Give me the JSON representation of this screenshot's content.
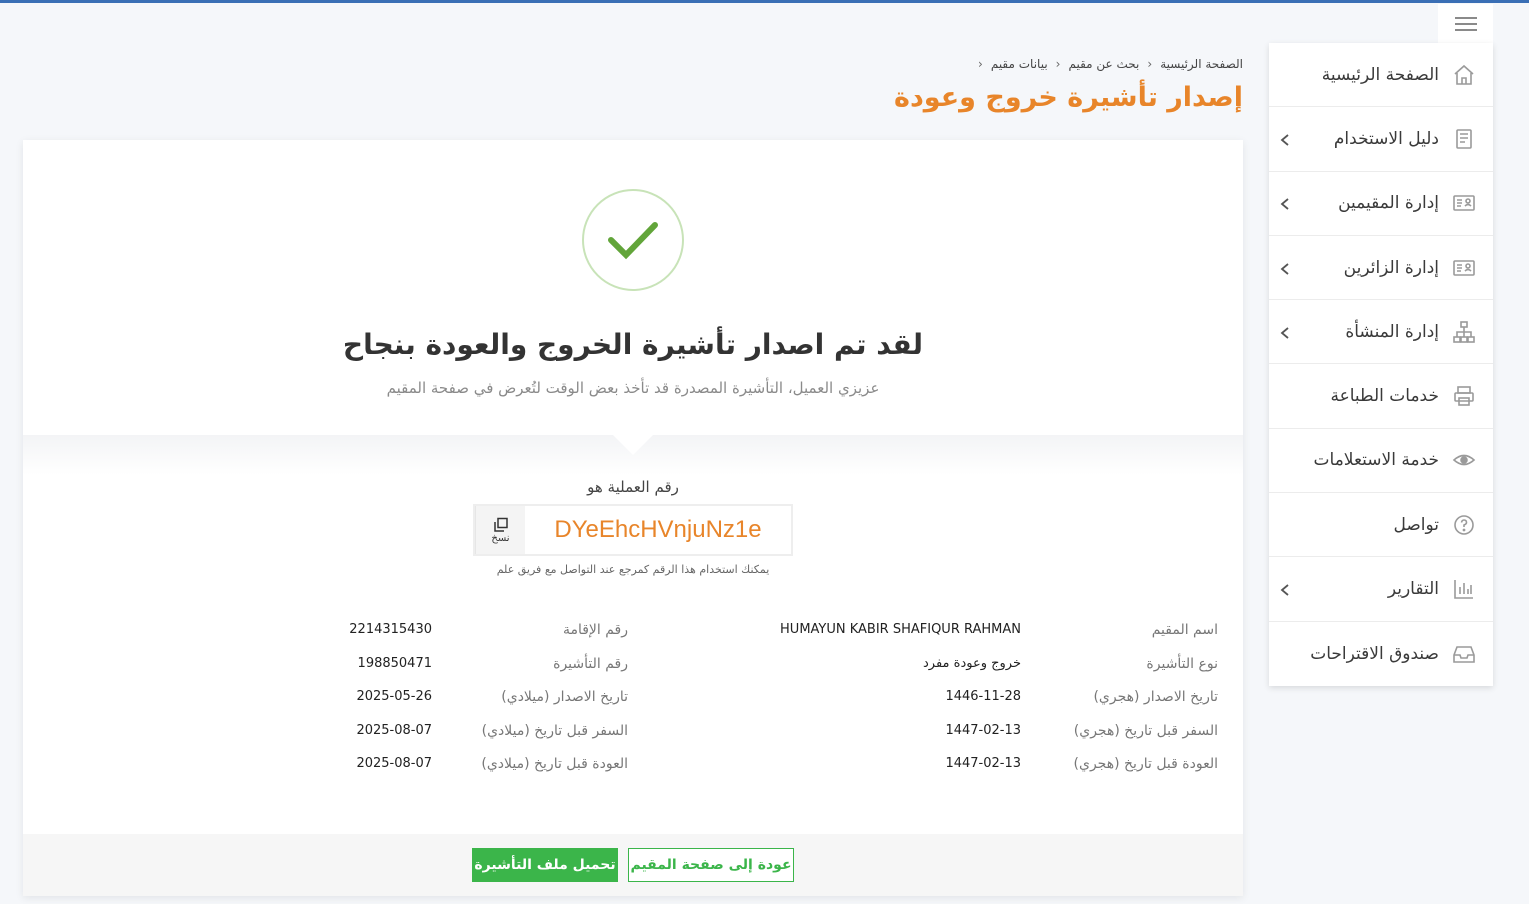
{
  "sidebar": {
    "items": [
      {
        "label": "الصفحة الرئيسية",
        "icon": "home-icon"
      },
      {
        "label": "دليل الاستخدام",
        "icon": "book-icon"
      },
      {
        "label": "إدارة المقيمين",
        "icon": "id-card-icon"
      },
      {
        "label": "إدارة الزائرين",
        "icon": "visitor-card-icon"
      },
      {
        "label": "إدارة المنشأة",
        "icon": "org-chart-icon"
      },
      {
        "label": "خدمات الطباعة",
        "icon": "printer-icon"
      },
      {
        "label": "خدمة الاستعلامات",
        "icon": "eye-icon"
      },
      {
        "label": "تواصل",
        "icon": "help-circle-icon"
      },
      {
        "label": "التقارير",
        "icon": "bar-chart-icon"
      },
      {
        "label": "صندوق الاقتراحات",
        "icon": "inbox-icon"
      }
    ]
  },
  "breadcrumb": {
    "home": "الصفحة الرئيسية",
    "search": "بحث عن مقيم",
    "current": "بيانات مقيم"
  },
  "page_title": "إصدار تأشيرة خروج وعودة",
  "success": {
    "title": "لقد تم اصدار تأشيرة الخروج والعودة بنجاح",
    "subtitle": "عزيزي العميل، التأشيرة المصدرة قد تأخذ بعض الوقت لتُعرض في صفحة المقيم"
  },
  "operation": {
    "label": "رقم العملية هو",
    "code": "DYeEhcHVnjuNz1e",
    "copy_label": "نسخ",
    "hint": "يمكنك استخدام هذا الرقم كمرجع عند التواصل مع فريق علم"
  },
  "details": {
    "resident_name_label": "اسم المقيم",
    "resident_name": "HUMAYUN KABIR SHAFIQUR RAHMAN",
    "iqama_label": "رقم الإقامة",
    "iqama": "2214315430",
    "visa_type_label": "نوع التأشيرة",
    "visa_type": "خروج وعودة مفرد",
    "visa_number_label": "رقم التأشيرة",
    "visa_number": "198850471",
    "issue_hijri_label": "تاريخ الاصدار (هجري)",
    "issue_hijri": "1446-11-28",
    "issue_greg_label": "تاريخ الاصدار (ميلادي)",
    "issue_greg": "2025-05-26",
    "travel_hijri_label": "السفر قبل تاريخ (هجري)",
    "travel_hijri": "1447-02-13",
    "travel_greg_label": "السفر قبل تاريخ (ميلادي)",
    "travel_greg": "2025-08-07",
    "return_hijri_label": "العودة قبل تاريخ (هجري)",
    "return_hijri": "1447-02-13",
    "return_greg_label": "العودة قبل تاريخ (ميلادي)",
    "return_greg": "2025-08-07"
  },
  "buttons": {
    "download": "تحميل ملف التأشيرة",
    "back": "عودة إلى صفحة المقيم"
  },
  "colors": {
    "accent": "#e8852a",
    "success": "#3bb54a",
    "topbar": "#3a6fb5"
  }
}
